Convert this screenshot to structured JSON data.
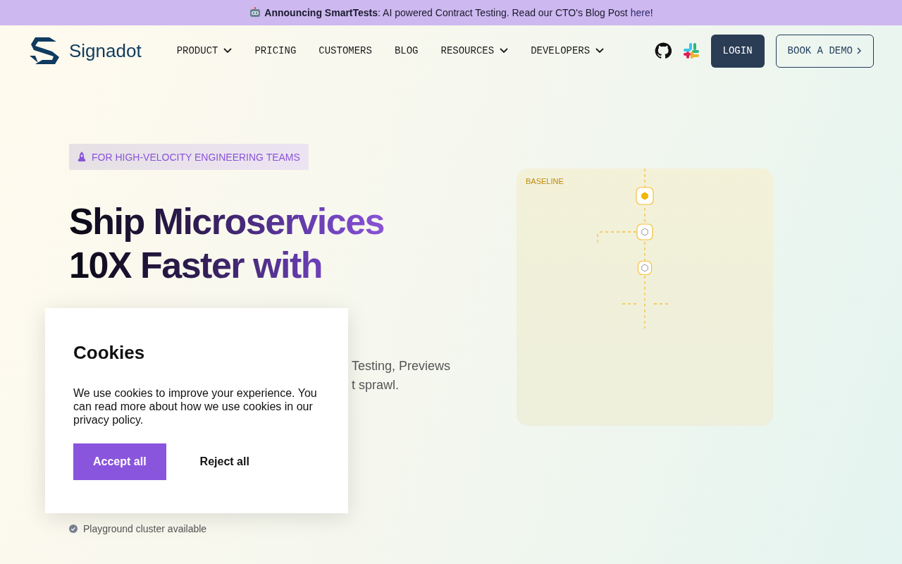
{
  "announcement": {
    "text": "**Announcing SmartTests**: AI powered Contract Testing. Read our CTO's Blog Post",
    "link": "here",
    "suffix": "!"
  },
  "header": {
    "brand": "Signadot",
    "nav": [
      {
        "label": "PRODUCT",
        "dropdown": true
      },
      {
        "label": "PRICING",
        "dropdown": false
      },
      {
        "label": "CUSTOMERS",
        "dropdown": false
      },
      {
        "label": "BLOG",
        "dropdown": false
      },
      {
        "label": "RESOURCES",
        "dropdown": true
      },
      {
        "label": "DEVELOPERS",
        "dropdown": true
      }
    ],
    "login": "LOGIN",
    "demo": "BOOK A DEMO"
  },
  "hero": {
    "badge": "FOR HIGH-VELOCITY ENGINEERING TEAMS",
    "headline": [
      "Ship Microservices",
      "10X Faster with"
    ],
    "description": [
      "Testing, Previews",
      "t sprawl."
    ],
    "checks": [
      "Playground cluster available"
    ]
  },
  "diagram": {
    "label": "BASELINE",
    "nodes": [
      {
        "active": true
      },
      {
        "active": false
      },
      {
        "active": false
      }
    ]
  },
  "cookies": {
    "title": "Cookies",
    "text": "We use cookies to improve your experience. You can read more about how we use cookies in our privacy policy.",
    "accept": "Accept all",
    "reject": "Reject all"
  }
}
